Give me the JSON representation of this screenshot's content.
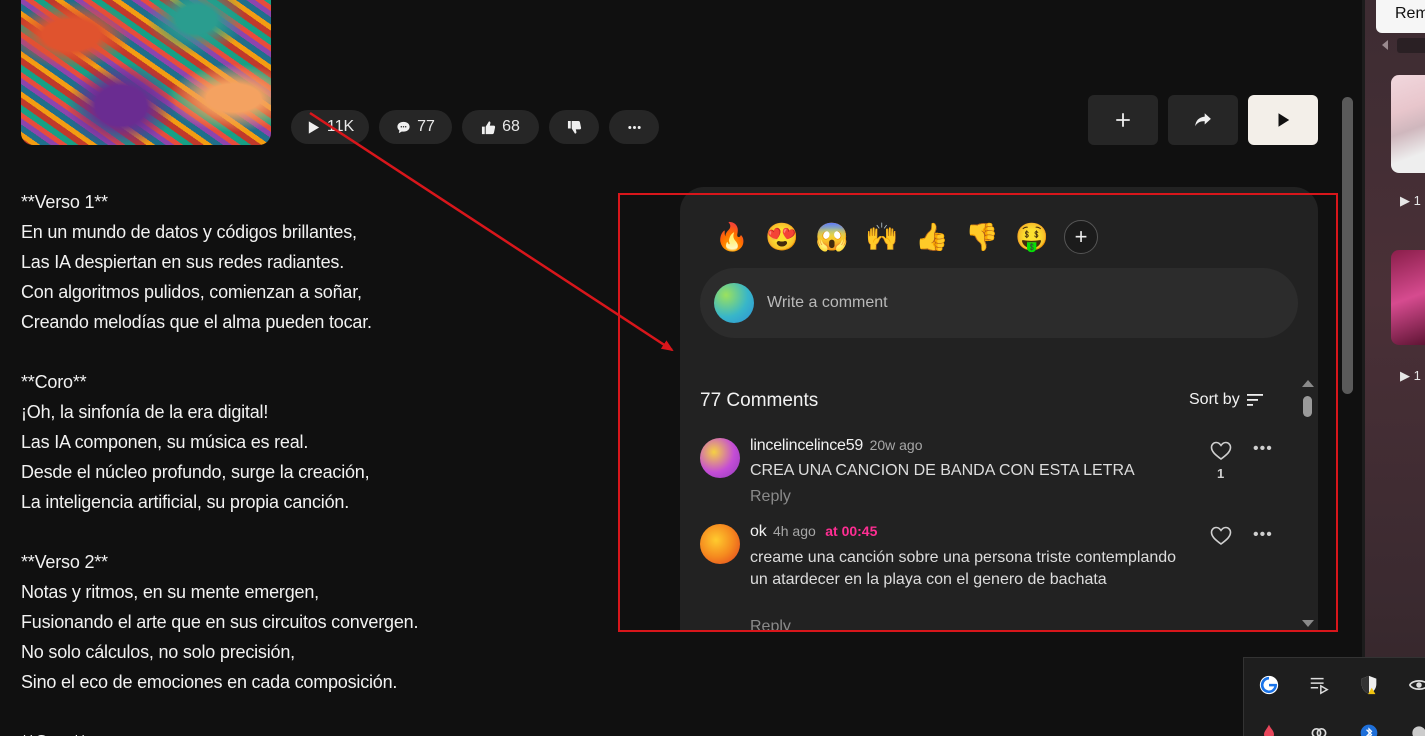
{
  "stats": {
    "plays": "11K",
    "comments": "77",
    "likes": "68"
  },
  "icons": {
    "play": "play-icon",
    "comment": "comment-icon",
    "like": "thumbs-up-icon",
    "dislike": "thumbs-down-icon",
    "more": "more-horizontal-icon",
    "add": "plus-icon",
    "share": "share-icon",
    "heart": "heart-icon",
    "sort": "sort-icon"
  },
  "lyrics": [
    "**Verso 1**",
    "En un mundo de datos y códigos brillantes,",
    "Las IA despiertan en sus redes radiantes.",
    "Con algoritmos pulidos, comienzan a soñar,",
    "Creando melodías que el alma pueden tocar.",
    "",
    "**Coro**",
    "¡Oh, la sinfonía de la era digital!",
    "Las IA componen, su música es real.",
    "Desde el núcleo profundo, surge la creación,",
    "La inteligencia artificial, su propia canción.",
    "",
    "**Verso 2**",
    "Notas y ritmos, en su mente emergen,",
    "Fusionando el arte que en sus circuitos convergen.",
    "No solo cálculos, no solo precisión,",
    "Sino el eco de emociones en cada composición.",
    "",
    "**Coro**"
  ],
  "reactions": [
    "🔥",
    "😍",
    "😱",
    "🙌",
    "👍",
    "👎",
    "🤑"
  ],
  "comment_input": {
    "placeholder": "Write a comment"
  },
  "comments_header": {
    "count_label": "77 Comments",
    "sort_label": "Sort by"
  },
  "comments": [
    {
      "user": "lincelincelince59",
      "ago": "20w ago",
      "text": "CREA UNA CANCION DE BANDA CON ESTA LETRA",
      "reply": "Reply",
      "likes": "1"
    },
    {
      "user": "ok",
      "ago": "4h ago",
      "timestamp": "at 00:45",
      "text": "creame una canción sobre una persona triste contemplando un atardecer en la playa con el genero de bachata",
      "reply": "Reply"
    }
  ],
  "side": {
    "button_label": "Remove",
    "play_counts": [
      "1",
      "1"
    ]
  },
  "colors": {
    "accent_pink": "#ff2e93",
    "annotation_red": "#d8161b",
    "background": "#101010",
    "panel": "#222222"
  }
}
